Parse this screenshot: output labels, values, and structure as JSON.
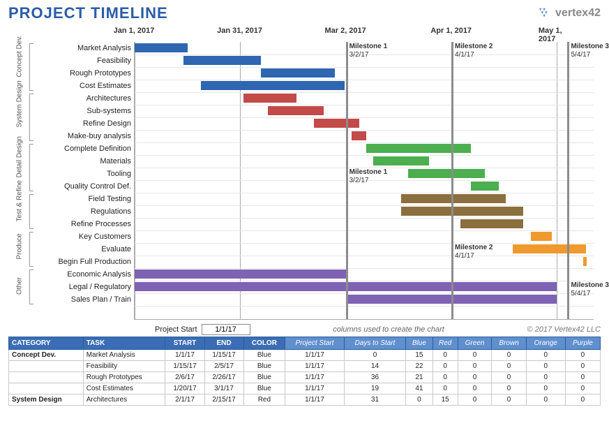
{
  "title": "PROJECT TIMELINE",
  "brand": "vertex42",
  "chart_data": {
    "type": "bar",
    "orientation": "horizontal-gantt",
    "x_axis": {
      "min_date": "2017-01-01",
      "max_date": "2017-05-11",
      "ticks": [
        "Jan 1, 2017",
        "Jan 31, 2017",
        "Mar 2, 2017",
        "Apr 1, 2017",
        "May 1, 2017"
      ],
      "tick_positions_pct": [
        0,
        23.0,
        46.0,
        69.0,
        92.0
      ]
    },
    "milestones": [
      {
        "name": "Milestone 1",
        "date": "3/2/17",
        "x_pct": 46.0,
        "label_y_rows": [
          0,
          10
        ]
      },
      {
        "name": "Milestone 2",
        "date": "4/1/17",
        "x_pct": 69.0,
        "label_y_rows": [
          0,
          16
        ]
      },
      {
        "name": "Milestone 3",
        "date": "5/4/17",
        "x_pct": 94.3,
        "label_y_rows": [
          0,
          19
        ]
      }
    ],
    "groups": [
      {
        "name": "Concept Dev.",
        "row_start": 0,
        "row_end": 3
      },
      {
        "name": "System Design",
        "row_start": 4,
        "row_end": 7
      },
      {
        "name": "Detail Design",
        "row_start": 8,
        "row_end": 11
      },
      {
        "name": "Test & Refine",
        "row_start": 12,
        "row_end": 14
      },
      {
        "name": "Produce",
        "row_start": 15,
        "row_end": 17
      },
      {
        "name": "Other",
        "row_start": 18,
        "row_end": 20
      }
    ],
    "colors": {
      "Blue": "#2e66b1",
      "Red": "#c24a49",
      "Green": "#4bae4f",
      "Brown": "#8b6f3e",
      "Orange": "#ef9a2d",
      "Purple": "#7e62b4"
    },
    "rows": [
      {
        "label": "Market Analysis",
        "color": "Blue",
        "start_pct": 0.0,
        "dur_pct": 11.5
      },
      {
        "label": "Feasibility",
        "color": "Blue",
        "start_pct": 10.7,
        "dur_pct": 16.8
      },
      {
        "label": "Rough Prototypes",
        "color": "Blue",
        "start_pct": 27.5,
        "dur_pct": 16.1
      },
      {
        "label": "Cost Estimates",
        "color": "Blue",
        "start_pct": 14.5,
        "dur_pct": 31.3
      },
      {
        "label": "Architectures",
        "color": "Red",
        "start_pct": 23.7,
        "dur_pct": 11.5
      },
      {
        "label": "Sub-systems",
        "color": "Red",
        "start_pct": 29.0,
        "dur_pct": 12.2
      },
      {
        "label": "Refine Design",
        "color": "Red",
        "start_pct": 39.0,
        "dur_pct": 9.9
      },
      {
        "label": "Make-buy analysis",
        "color": "Red",
        "start_pct": 47.3,
        "dur_pct": 3.1
      },
      {
        "label": "Complete Definition",
        "color": "Green",
        "start_pct": 50.4,
        "dur_pct": 22.9
      },
      {
        "label": "Materials",
        "color": "Green",
        "start_pct": 51.9,
        "dur_pct": 12.2
      },
      {
        "label": "Tooling",
        "color": "Green",
        "start_pct": 59.5,
        "dur_pct": 16.8
      },
      {
        "label": "Quality Control Def.",
        "color": "Green",
        "start_pct": 73.3,
        "dur_pct": 6.1
      },
      {
        "label": "Field Testing",
        "color": "Brown",
        "start_pct": 58.0,
        "dur_pct": 22.9
      },
      {
        "label": "Regulations",
        "color": "Brown",
        "start_pct": 58.0,
        "dur_pct": 26.7
      },
      {
        "label": "Refine Processes",
        "color": "Brown",
        "start_pct": 71.0,
        "dur_pct": 13.7
      },
      {
        "label": "Key Customers",
        "color": "Orange",
        "start_pct": 86.3,
        "dur_pct": 4.6
      },
      {
        "label": "Evaluate",
        "color": "Orange",
        "start_pct": 82.4,
        "dur_pct": 16.0
      },
      {
        "label": "Begin Full Production",
        "color": "Orange",
        "start_pct": 97.7,
        "dur_pct": 0.8
      },
      {
        "label": "Economic Analysis",
        "color": "Purple",
        "start_pct": 0.0,
        "dur_pct": 46.0
      },
      {
        "label": "Legal / Regulatory",
        "color": "Purple",
        "start_pct": 0.0,
        "dur_pct": 92.0
      },
      {
        "label": "Sales Plan / Train",
        "color": "Purple",
        "start_pct": 46.0,
        "dur_pct": 46.0
      }
    ]
  },
  "controls": {
    "project_start_label": "Project Start",
    "project_start_value": "1/1/17",
    "hint": "columns used to create the chart",
    "copyright": "© 2017 Vertex42 LLC"
  },
  "table": {
    "headers_main": [
      "CATEGORY",
      "TASK",
      "START",
      "END",
      "COLOR"
    ],
    "headers_calc": [
      "Project Start",
      "Days to Start",
      "Blue",
      "Red",
      "Green",
      "Brown",
      "Orange",
      "Purple"
    ],
    "rows": [
      {
        "category": "Concept Dev.",
        "task": "Market Analysis",
        "start": "1/1/17",
        "end": "1/15/17",
        "color": "Blue",
        "ps": "1/1/17",
        "dts": 0,
        "b": 15,
        "r": 0,
        "g": 0,
        "br": 0,
        "o": 0,
        "p": 0
      },
      {
        "category": "",
        "task": "Feasibility",
        "start": "1/15/17",
        "end": "2/5/17",
        "color": "Blue",
        "ps": "1/1/17",
        "dts": 14,
        "b": 22,
        "r": 0,
        "g": 0,
        "br": 0,
        "o": 0,
        "p": 0
      },
      {
        "category": "",
        "task": "Rough Prototypes",
        "start": "2/6/17",
        "end": "2/26/17",
        "color": "Blue",
        "ps": "1/1/17",
        "dts": 36,
        "b": 21,
        "r": 0,
        "g": 0,
        "br": 0,
        "o": 0,
        "p": 0
      },
      {
        "category": "",
        "task": "Cost Estimates",
        "start": "1/20/17",
        "end": "3/1/17",
        "color": "Blue",
        "ps": "1/1/17",
        "dts": 19,
        "b": 41,
        "r": 0,
        "g": 0,
        "br": 0,
        "o": 0,
        "p": 0
      },
      {
        "category": "System Design",
        "task": "Architectures",
        "start": "2/1/17",
        "end": "2/15/17",
        "color": "Red",
        "ps": "1/1/17",
        "dts": 31,
        "b": 0,
        "r": 15,
        "g": 0,
        "br": 0,
        "o": 0,
        "p": 0
      }
    ]
  }
}
